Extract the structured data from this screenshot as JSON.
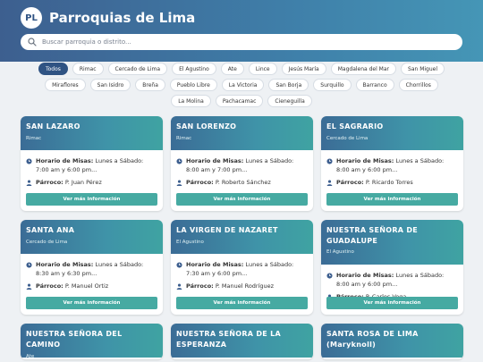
{
  "header": {
    "logo_text": "PL",
    "title": "Parroquias de Lima",
    "search_placeholder": "Buscar parroquia o distrito..."
  },
  "filters": [
    "Todos",
    "Rimac",
    "Cercado de Lima",
    "El Agustino",
    "Ate",
    "Lince",
    "Jesús María",
    "Magdalena del Mar",
    "San Miguel",
    "Miraflores",
    "San Isidro",
    "Breña",
    "Pueblo Libre",
    "La Victoria",
    "San Borja",
    "Surquillo",
    "Barranco",
    "Chorrillos",
    "La Molina",
    "Pachacamac",
    "Cieneguilla"
  ],
  "active_filter": "Todos",
  "labels": {
    "schedule": "Horario de Misas:",
    "priest": "Párroco:",
    "more": "Ver más información"
  },
  "parishes": [
    {
      "name": "SAN LAZARO",
      "district": "Rimac",
      "schedule_1": "Lunes a Sábado:",
      "schedule_2": "7:00 am y 6:00 pm...",
      "priest": "P. Juan Pérez"
    },
    {
      "name": "SAN LORENZO",
      "district": "Rimac",
      "schedule_1": "Lunes a Sábado:",
      "schedule_2": "8:00 am y 7:00 pm...",
      "priest": "P. Roberto Sánchez"
    },
    {
      "name": "EL SAGRARIO",
      "district": "Cercado de Lima",
      "schedule_1": "Lunes a Sábado:",
      "schedule_2": "8:00 am y 6:00 pm...",
      "priest": "P. Ricardo Torres"
    },
    {
      "name": "SANTA ANA",
      "district": "Cercado de Lima",
      "schedule_1": "Lunes a Sábado:",
      "schedule_2": "8:30 am y 6:30 pm...",
      "priest": "P. Manuel Ortiz"
    },
    {
      "name": "LA VIRGEN DE NAZARET",
      "district": "El Agustino",
      "schedule_1": "Lunes a Sábado:",
      "schedule_2": "7:30 am y 6:00 pm...",
      "priest": "P. Manuel Rodríguez"
    },
    {
      "name": "NUESTRA SEÑORA DE GUADALUPE",
      "district": "El Agustino",
      "schedule_1": "Lunes a Sábado:",
      "schedule_2": "8:00 am y 6:00 pm...",
      "priest": "P. Carlos Vega"
    },
    {
      "name": "NUESTRA SEÑORA DEL CAMINO",
      "district": "Ate"
    },
    {
      "name": "NUESTRA SEÑORA DE LA ESPERANZA",
      "district": ""
    },
    {
      "name": "SANTA ROSA DE LIMA (Maryknoll)",
      "district": ""
    }
  ],
  "colors": {
    "header_start": "#3d5f8f",
    "header_end": "#4596b6",
    "card_head_start": "#3b6c96",
    "card_head_end": "#3fa3a2",
    "button": "#46aaa2",
    "active_chip": "#2f5383"
  },
  "icons": {
    "search": "search-icon",
    "clock": "clock-icon",
    "person": "person-icon"
  }
}
